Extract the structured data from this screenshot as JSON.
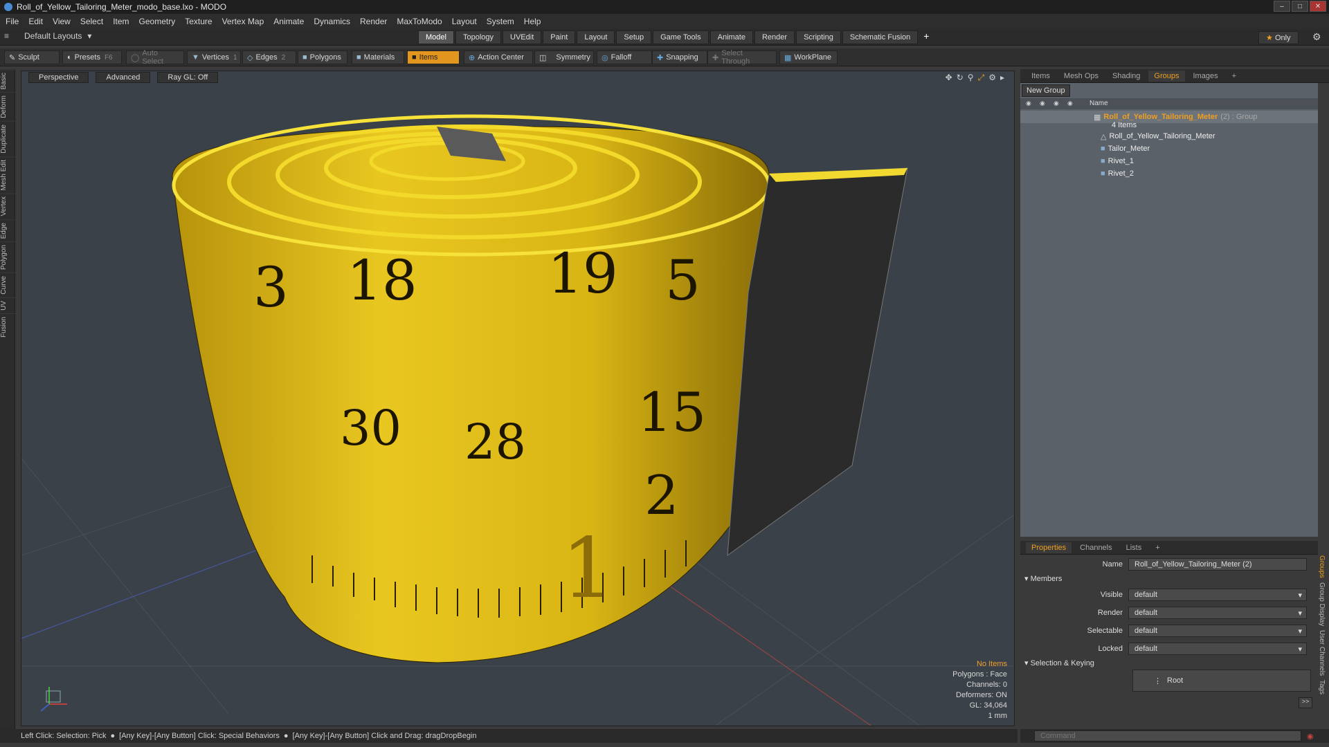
{
  "window": {
    "title": "Roll_of_Yellow_Tailoring_Meter_modo_base.lxo - MODO"
  },
  "menu": [
    "File",
    "Edit",
    "View",
    "Select",
    "Item",
    "Geometry",
    "Texture",
    "Vertex Map",
    "Animate",
    "Dynamics",
    "Render",
    "MaxToModo",
    "Layout",
    "System",
    "Help"
  ],
  "layout_bar": {
    "layout_name": "Default Layouts",
    "tabs": [
      "Model",
      "Topology",
      "UVEdit",
      "Paint",
      "Layout",
      "Setup",
      "Game Tools",
      "Animate",
      "Render",
      "Scripting",
      "Schematic Fusion"
    ],
    "active_tab": "Model",
    "only_label": "Only"
  },
  "toolbar": {
    "sculpt": "Sculpt",
    "presets": "Presets",
    "presets_key": "F6",
    "auto_select": "Auto Select",
    "vertices": "Vertices",
    "vertices_count": "1",
    "edges": "Edges",
    "edges_count": "2",
    "polygons": "Polygons",
    "materials": "Materials",
    "items": "Items",
    "action_center": "Action Center",
    "symmetry": "Symmetry",
    "falloff": "Falloff",
    "snapping": "Snapping",
    "select_through": "Select Through",
    "workplane": "WorkPlane"
  },
  "left_tabs": [
    "Basic",
    "Deform",
    "Duplicate",
    "Mesh Edit",
    "Vertex",
    "Edge",
    "Polygon",
    "Curve",
    "UV",
    "Fusion"
  ],
  "viewport": {
    "view": "Perspective",
    "shading": "Advanced",
    "raygl": "Ray GL: Off",
    "tape_numbers": [
      "3",
      "18",
      "19",
      "5",
      "15",
      "2",
      "30",
      "28",
      "1"
    ],
    "info": {
      "selection": "No Items",
      "polygons": "Polygons : Face",
      "channels": "Channels: 0",
      "deformers": "Deformers: ON",
      "gl": "GL: 34,064",
      "units": "1 mm"
    }
  },
  "status": {
    "line1": "Left Click: Selection: Pick",
    "line2": "[Any Key]-[Any Button] Click: Special Behaviors",
    "line3": "[Any Key]-[Any Button] Click and Drag: dragDropBegin"
  },
  "right_tabs": [
    "Items",
    "Mesh Ops",
    "Shading",
    "Groups",
    "Images"
  ],
  "right_tab_active": "Groups",
  "groups": {
    "new_group": "New Group",
    "col_name": "Name",
    "group_name": "Roll_of_Yellow_Tailoring_Meter",
    "group_suffix": "(2) : Group",
    "items_count": "4 Items",
    "children": [
      "Roll_of_Yellow_Tailoring_Meter",
      "Tailor_Meter",
      "Rivet_1",
      "Rivet_2"
    ]
  },
  "props_tabs": [
    "Properties",
    "Channels",
    "Lists"
  ],
  "properties": {
    "name_label": "Name",
    "name_value": "Roll_of_Yellow_Tailoring_Meter (2)",
    "members": "Members",
    "visible_label": "Visible",
    "visible_value": "default",
    "render_label": "Render",
    "render_value": "default",
    "selectable_label": "Selectable",
    "selectable_value": "default",
    "locked_label": "Locked",
    "locked_value": "default",
    "sel_keying": "Selection & Keying",
    "root": "Root",
    "more": ">>"
  },
  "side_vtabs": [
    "Groups",
    "Group Display",
    "User Channels",
    "Tags"
  ],
  "command_placeholder": "Command",
  "colors": {
    "accent": "#f0a020",
    "tape_yellow": "#e8c21a",
    "viewport_bg": "#3b4148"
  }
}
